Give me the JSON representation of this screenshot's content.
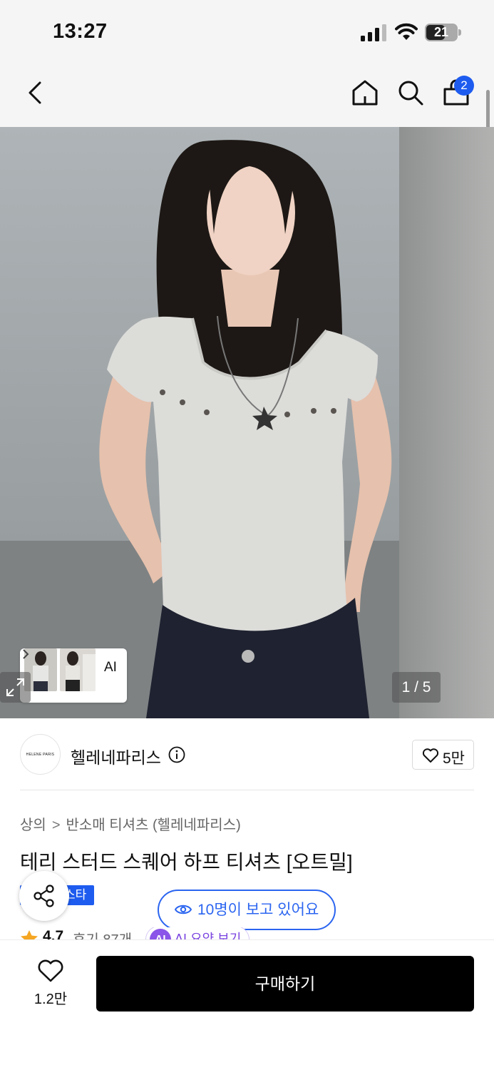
{
  "status_bar": {
    "time": "13:27",
    "battery": "21"
  },
  "nav": {
    "cart_count": "2"
  },
  "gallery": {
    "counter": "1 / 5",
    "ai_label": "AI"
  },
  "brand": {
    "logo_text": "HELENE PARIS",
    "name": "헬레네파리스",
    "likes": "5만"
  },
  "product": {
    "breadcrumb": [
      "상의",
      "반소매 티셔츠 (헬레네파리스)"
    ],
    "title": "테리 스터드 스퀘어 하프 티셔츠 [오트밀]",
    "tag": "스타",
    "viewers": "10명이 보고 있어요",
    "rating": "4.7",
    "reviews": "후기 87개",
    "ai_summary_icon": "AI",
    "ai_summary": "AI 요약 보기"
  },
  "bottom": {
    "wish_count": "1.2만",
    "buy_label": "구매하기"
  },
  "colors": {
    "accent": "#1e5cf0",
    "ai_purple": "#8a55e8",
    "buy_bg": "#000000"
  }
}
